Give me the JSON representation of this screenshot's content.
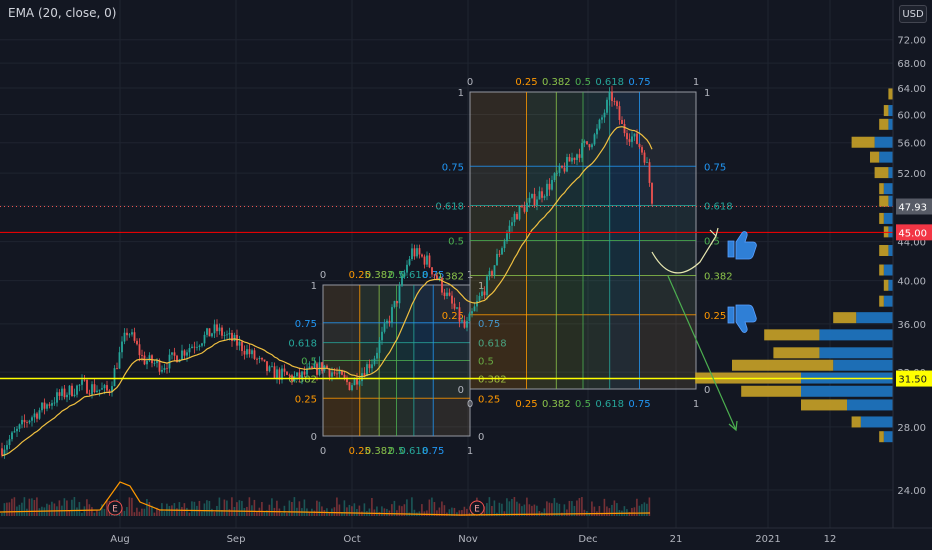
{
  "legend": {
    "indicator": "EMA (20, close, 0)"
  },
  "currency_button": "USD",
  "colors": {
    "background": "#131722",
    "candle_up": "#26a69a",
    "candle_down": "#ef5350",
    "ema": "#f0c040",
    "red_line": "#ff0000",
    "yellow_line": "#ffff00",
    "fib_orange": "#ff9800",
    "fib_green": "#4caf50",
    "fib_blue": "#2196f3",
    "arrow": "#4caf50",
    "label_red": "#f23645",
    "label_gray": "#575b66",
    "volume_profile_gold": "#c9a227",
    "volume_profile_blue": "#1e73be"
  },
  "chart_data": {
    "type": "candlestick",
    "price_axis": {
      "ticks": [
        "72.00",
        "68.00",
        "64.00",
        "60.00",
        "56.00",
        "52.00",
        "48.00",
        "44.00",
        "40.00",
        "36.00",
        "32.00",
        "28.00",
        "24.00"
      ],
      "scale": "log"
    },
    "time_axis": {
      "ticks": [
        "Aug",
        "Sep",
        "Oct",
        "Nov",
        "Dec",
        "21",
        "2021",
        "12"
      ]
    },
    "price_labels": [
      {
        "value": "47.93",
        "style": "gray"
      },
      {
        "value": "45.00",
        "style": "red"
      },
      {
        "value": "31.50",
        "style": "yellow"
      }
    ],
    "horizontal_lines": [
      {
        "price": 45.0,
        "color": "red"
      },
      {
        "price": 31.5,
        "color": "yellow"
      },
      {
        "price": 47.93,
        "color": "dotted"
      }
    ],
    "price_path": [
      {
        "date": "2020-07-01",
        "close": 26.5
      },
      {
        "date": "2020-07-08",
        "close": 28.5
      },
      {
        "date": "2020-07-15",
        "close": 30.0
      },
      {
        "date": "2020-07-22",
        "close": 31.0
      },
      {
        "date": "2020-07-29",
        "close": 30.5
      },
      {
        "date": "2020-08-03",
        "close": 35.5
      },
      {
        "date": "2020-08-07",
        "close": 33.0
      },
      {
        "date": "2020-08-12",
        "close": 32.5
      },
      {
        "date": "2020-08-19",
        "close": 34.0
      },
      {
        "date": "2020-08-26",
        "close": 35.5
      },
      {
        "date": "2020-09-02",
        "close": 34.0
      },
      {
        "date": "2020-09-09",
        "close": 32.0
      },
      {
        "date": "2020-09-16",
        "close": 31.5
      },
      {
        "date": "2020-09-23",
        "close": 32.5
      },
      {
        "date": "2020-09-30",
        "close": 31.0
      },
      {
        "date": "2020-10-06",
        "close": 33.0
      },
      {
        "date": "2020-10-12",
        "close": 38.0
      },
      {
        "date": "2020-10-16",
        "close": 43.0
      },
      {
        "date": "2020-10-20",
        "close": 42.0
      },
      {
        "date": "2020-10-26",
        "close": 38.0
      },
      {
        "date": "2020-10-30",
        "close": 35.5
      },
      {
        "date": "2020-11-05",
        "close": 40.0
      },
      {
        "date": "2020-11-12",
        "close": 47.0
      },
      {
        "date": "2020-11-20",
        "close": 50.0
      },
      {
        "date": "2020-11-27",
        "close": 54.0
      },
      {
        "date": "2020-12-03",
        "close": 57.0
      },
      {
        "date": "2020-12-07",
        "close": 63.0
      },
      {
        "date": "2020-12-10",
        "close": 58.0
      },
      {
        "date": "2020-12-14",
        "close": 56.0
      },
      {
        "date": "2020-12-16",
        "close": 54.0
      },
      {
        "date": "2020-12-18",
        "close": 47.93
      }
    ],
    "ema_label": "EMA (20, close, 0)",
    "fib_grids": [
      {
        "levels_x": [
          "0",
          "0.25",
          "0.382",
          "0.5",
          "0.618",
          "0.75",
          "1"
        ],
        "levels_y": [
          "0",
          "0.25",
          "0.382",
          "0.5",
          "0.618",
          "0.75",
          "1"
        ]
      },
      {
        "levels_x": [
          "0",
          "0.25",
          "0.382",
          "0.5",
          "0.618",
          "0.75",
          "1"
        ],
        "levels_y": [
          "0",
          "0.25",
          "0.382",
          "0.5",
          "0.618",
          "0.75",
          "1"
        ]
      }
    ],
    "earnings_markers": [
      "E",
      "E"
    ],
    "volume_profile_rows": [
      {
        "price": 63.0,
        "gold": 1,
        "blue": 0
      },
      {
        "price": 60.5,
        "gold": 1,
        "blue": 1
      },
      {
        "price": 58.5,
        "gold": 2,
        "blue": 1
      },
      {
        "price": 56.0,
        "gold": 5,
        "blue": 4
      },
      {
        "price": 54.0,
        "gold": 2,
        "blue": 3
      },
      {
        "price": 52.0,
        "gold": 3,
        "blue": 1
      },
      {
        "price": 50.0,
        "gold": 1,
        "blue": 2
      },
      {
        "price": 48.5,
        "gold": 2,
        "blue": 1
      },
      {
        "price": 46.5,
        "gold": 1,
        "blue": 2
      },
      {
        "price": 45.0,
        "gold": 1,
        "blue": 1
      },
      {
        "price": 43.0,
        "gold": 2,
        "blue": 1
      },
      {
        "price": 41.0,
        "gold": 1,
        "blue": 2
      },
      {
        "price": 39.5,
        "gold": 1,
        "blue": 1
      },
      {
        "price": 38.0,
        "gold": 1,
        "blue": 2
      },
      {
        "price": 36.5,
        "gold": 5,
        "blue": 8
      },
      {
        "price": 35.0,
        "gold": 12,
        "blue": 16
      },
      {
        "price": 33.5,
        "gold": 10,
        "blue": 16
      },
      {
        "price": 32.5,
        "gold": 22,
        "blue": 13
      },
      {
        "price": 31.5,
        "gold": 23,
        "blue": 20
      },
      {
        "price": 30.5,
        "gold": 13,
        "blue": 20
      },
      {
        "price": 29.5,
        "gold": 10,
        "blue": 10
      },
      {
        "price": 28.3,
        "gold": 2,
        "blue": 7
      },
      {
        "price": 27.3,
        "gold": 1,
        "blue": 2
      }
    ]
  }
}
